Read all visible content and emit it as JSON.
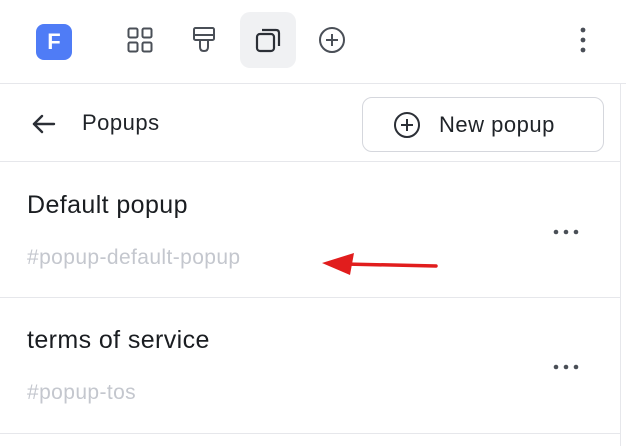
{
  "topbar": {
    "logo_letter": "F",
    "tools": [
      {
        "icon": "grid-icon",
        "active": false
      },
      {
        "icon": "paint-roller-icon",
        "active": false
      },
      {
        "icon": "popups-stack-icon",
        "active": true
      },
      {
        "icon": "plus-circle-icon",
        "active": false
      }
    ],
    "menu_icon": "vertical-ellipsis-icon"
  },
  "header": {
    "back_icon": "arrow-left-icon",
    "title": "Popups",
    "new_button_icon": "plus-circle-icon",
    "new_button_label": "New popup"
  },
  "popups": [
    {
      "name": "Default popup",
      "slug": "#popup-default-popup",
      "menu_icon": "horizontal-ellipsis-icon"
    },
    {
      "name": "terms of service",
      "slug": "#popup-tos",
      "menu_icon": "horizontal-ellipsis-icon"
    }
  ],
  "annotation": {
    "icon": "red-arrow-icon",
    "color": "#e11d1d"
  },
  "colors": {
    "accent": "#4f7cf6",
    "active_tool_bg": "#f0f1f3",
    "muted_text": "#c4c7ce",
    "border": "#e6e7eb"
  }
}
